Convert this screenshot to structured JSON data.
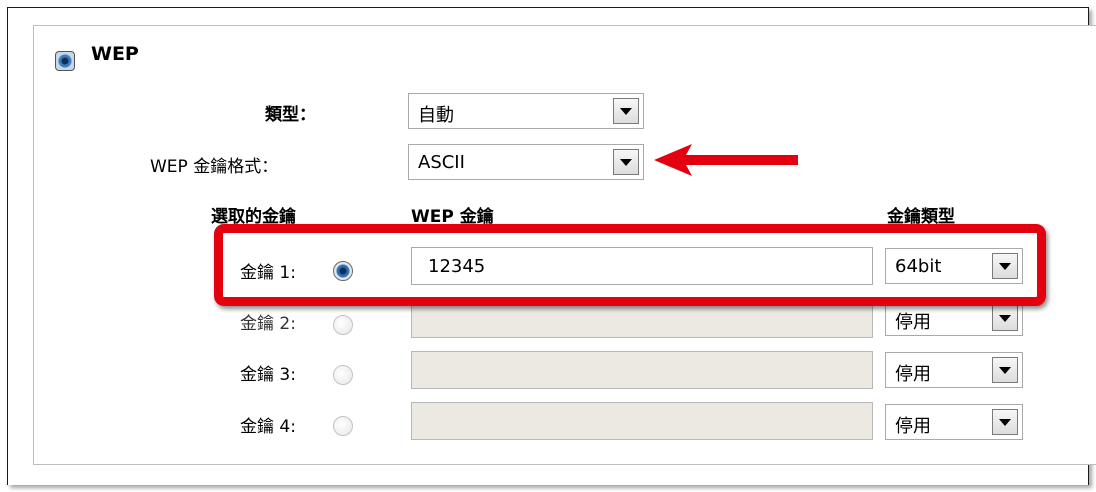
{
  "wep": {
    "title": "WEP",
    "type_label": "類型：",
    "type_value": "自動",
    "format_label": "WEP 金鑰格式：",
    "format_value": "ASCII"
  },
  "table": {
    "headers": {
      "selected": "選取的金鑰",
      "key": "WEP 金鑰",
      "key_type": "金鑰類型"
    },
    "rows": [
      {
        "label": "金鑰 1:",
        "selected": true,
        "value": "12345",
        "type": "64bit",
        "enabled": true
      },
      {
        "label": "金鑰 2:",
        "selected": false,
        "value": "",
        "type": "停用",
        "enabled": false
      },
      {
        "label": "金鑰 3:",
        "selected": false,
        "value": "",
        "type": "停用",
        "enabled": false
      },
      {
        "label": "金鑰 4:",
        "selected": false,
        "value": "",
        "type": "停用",
        "enabled": false
      }
    ]
  },
  "annotations": {
    "highlight_color": "#e3000f",
    "arrow_color": "#e3000f"
  }
}
